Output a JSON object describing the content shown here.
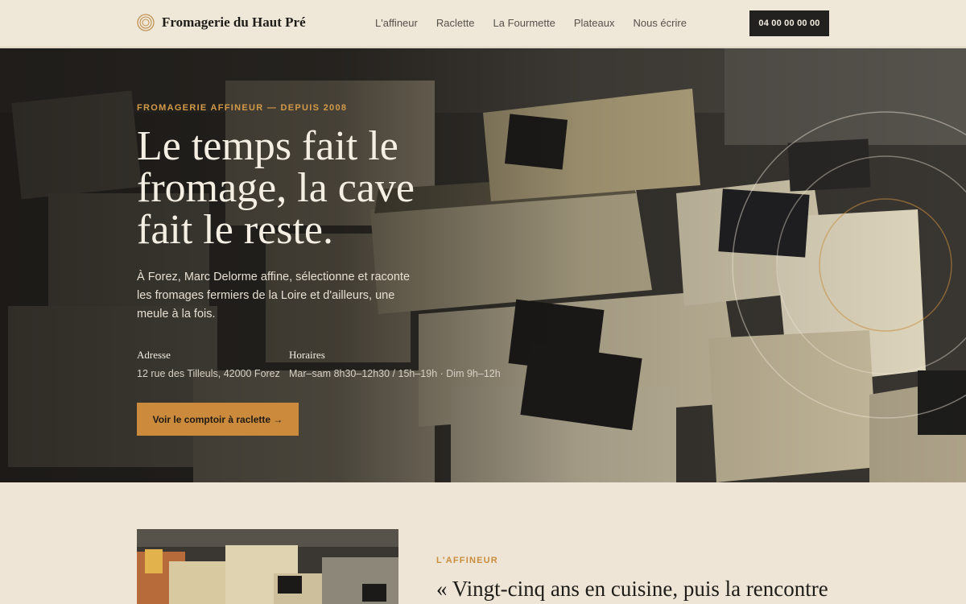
{
  "header": {
    "brand": "Fromagerie du Haut Pré",
    "nav": [
      "L'affineur",
      "Raclette",
      "La Fourmette",
      "Plateaux",
      "Nous écrire"
    ],
    "phone": "04 00 00 00 00"
  },
  "hero": {
    "eyebrow": "FROMAGERIE AFFINEUR — DEPUIS 2008",
    "title": "Le temps fait le fromage, la cave fait le reste.",
    "text": "À Forez, Marc Delorme affine, sélectionne et raconte les fromages fermiers de la Loire et d'ailleurs, une meule à la fois.",
    "address": {
      "label": "Adresse",
      "value": "12 rue des Tilleuls, 42000 Forez"
    },
    "hours": {
      "label": "Horaires",
      "value": "Mar–sam 8h30–12h30 / 15h–19h · Dim 9h–12h"
    },
    "cta": "Voir le comptoir à raclette →"
  },
  "section": {
    "eyebrow": "L'AFFINEUR",
    "quote": "« Vingt-cinq ans en cuisine, puis la rencontre"
  },
  "colors": {
    "accent": "#cb8a3c",
    "background": "#eee5d6",
    "dark": "#23211f"
  }
}
